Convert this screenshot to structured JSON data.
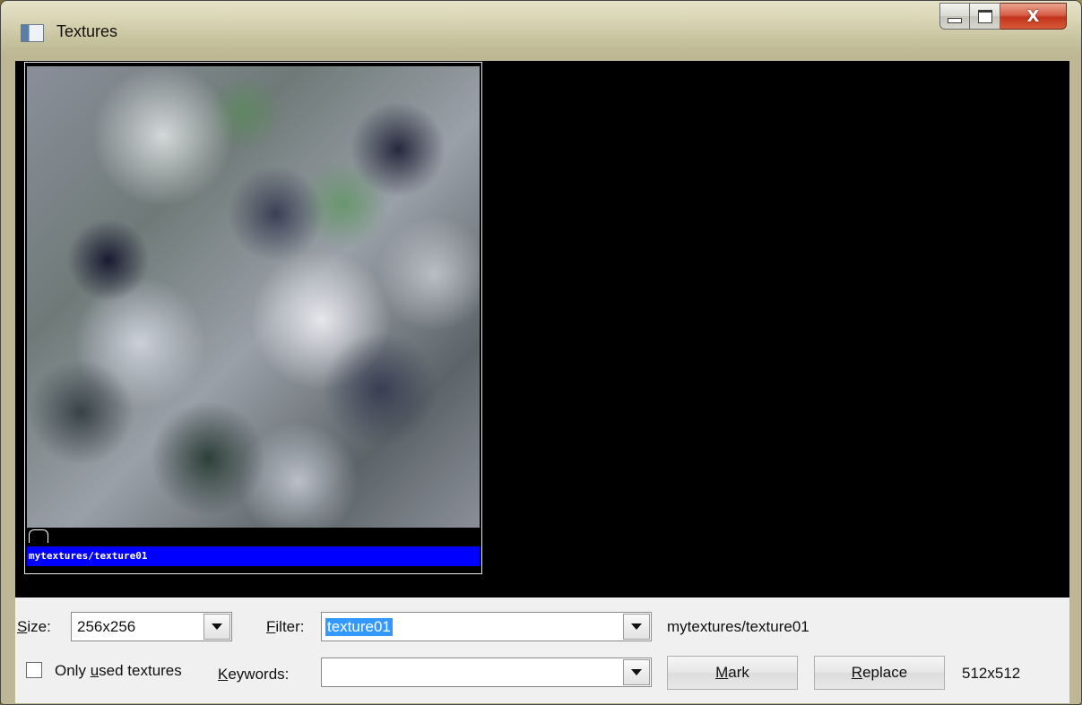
{
  "window": {
    "title": "Textures",
    "buttons": {
      "minimize": "minimize",
      "maximize": "maximize",
      "close": "X"
    }
  },
  "viewport": {
    "textures": [
      {
        "name": "mytextures/texture01"
      }
    ]
  },
  "controls": {
    "size_label_prefix": "",
    "size_label_underlined": "S",
    "size_label_rest": "ize:",
    "size_value": "256x256",
    "filter_label_underlined": "F",
    "filter_label_rest": "ilter:",
    "filter_value": "texture01",
    "selected_texture": "mytextures/texture01",
    "only_used_prefix": "Only ",
    "only_used_underlined": "u",
    "only_used_rest": "sed textures",
    "only_used_checked": false,
    "keywords_label_underlined": "K",
    "keywords_label_rest": "eywords:",
    "keywords_value": "",
    "mark_underlined": "M",
    "mark_rest": "ark",
    "replace_underlined": "R",
    "replace_rest": "eplace",
    "texture_dimensions": "512x512"
  },
  "icons": {
    "app": "texture-window-icon",
    "dropdown": "chevron-down-icon"
  }
}
